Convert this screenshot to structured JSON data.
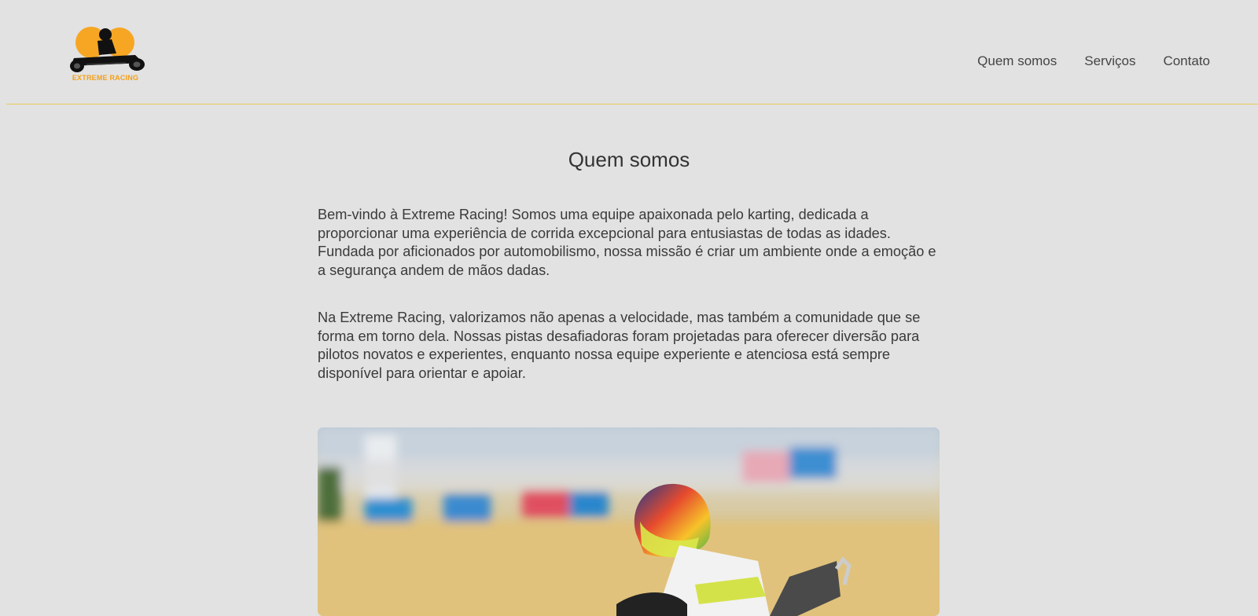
{
  "header": {
    "logo_text": "EXTREME RACING",
    "nav": [
      "Quem somos",
      "Serviços",
      "Contato"
    ]
  },
  "main": {
    "title": "Quem somos",
    "paragraphs": [
      "Bem-vindo à Extreme Racing! Somos uma equipe apaixonada pelo karting, dedicada a proporcionar uma experiência de corrida excepcional para entusiastas de todas as idades. Fundada por aficionados por automobilismo, nossa missão é criar um ambiente onde a emoção e a segurança andem de mãos dadas.",
      "Na Extreme Racing, valorizamos não apenas a velocidade, mas também a comunidade que se forma em torno dela. Nossas pistas desafiadoras foram projetadas para oferecer diversão para pilotos novatos e experientes, enquanto nossa equipe experiente e atenciosa está sempre disponível para orientar e apoiar."
    ]
  },
  "colors": {
    "background": "#e2e2e2",
    "header_border": "#e8cc55",
    "logo_accent": "#f3a01a"
  }
}
